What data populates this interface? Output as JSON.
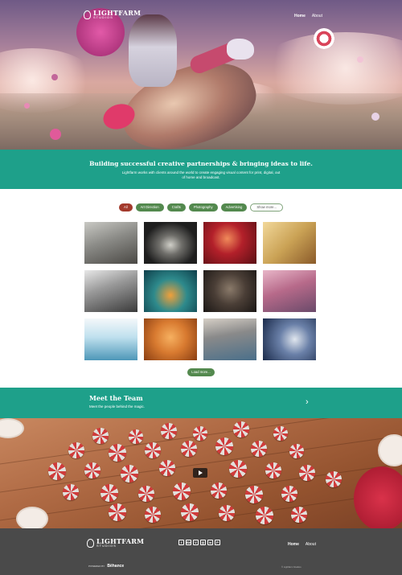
{
  "brand": {
    "name": "LIGHTFARM",
    "sub": "STUDIOS"
  },
  "nav": {
    "home": "Home",
    "about": "About"
  },
  "banner": {
    "headline": "Building successful creative partnerships & bringing ideas to life.",
    "description": "Lightfarm works with clients around the world to create engaging visual content for print, digital, out of home and broadcast."
  },
  "filters": {
    "all": "All",
    "art_direction": "Art Direction",
    "crafts": "Crafts",
    "photography": "Photography",
    "advertising": "Advertising",
    "show_more": "Show more..."
  },
  "projects": [
    {
      "color": "#8a8a86"
    },
    {
      "color": "#2b2b2b"
    },
    {
      "color": "#b3202a"
    },
    {
      "color": "#caa255"
    },
    {
      "color": "#6a6a6a"
    },
    {
      "color": "#2e8a8c"
    },
    {
      "color": "#4a3e36"
    },
    {
      "color": "#b76a8a"
    },
    {
      "color": "#4d97b8"
    },
    {
      "color": "#d87a30"
    },
    {
      "color": "#4a6f8a"
    },
    {
      "color": "#2a3e6a"
    }
  ],
  "load_more": "Load more...",
  "team": {
    "title": "Meet the Team",
    "subtitle": "Meet the people behind the magic.",
    "arrow": "›"
  },
  "footer": {
    "home": "Home",
    "about": "About",
    "social": [
      "f",
      "Bē",
      "V",
      "◎",
      "in",
      "P"
    ],
    "powered_by": "POWERED BY",
    "behance": "Bēhance",
    "copyright": "© Lightfarm Studios"
  },
  "colors": {
    "teal": "#1ea08a",
    "green": "#53894e",
    "red": "#a33a2c",
    "footer": "#4a4a4a"
  }
}
